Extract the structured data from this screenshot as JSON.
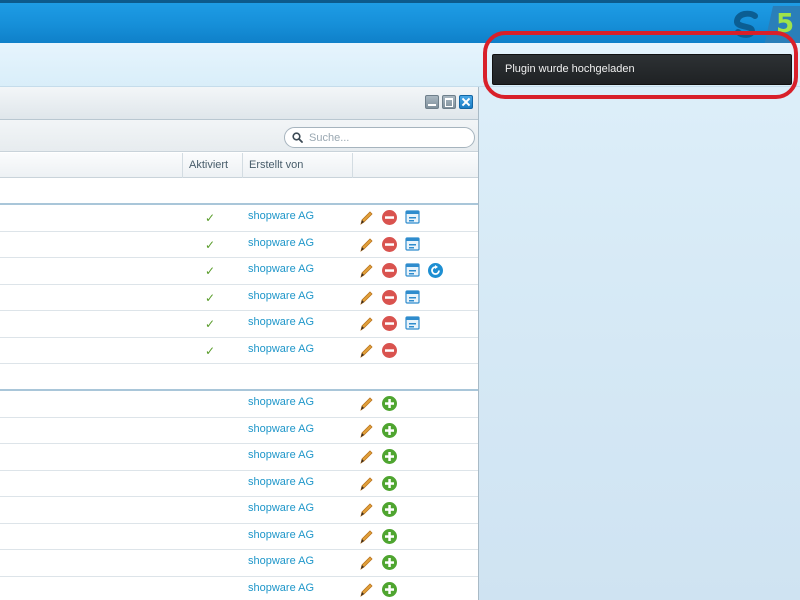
{
  "header": {
    "logo_icon": "shopware-5-logo",
    "logo_text": "5",
    "brand_colors": {
      "bar": "#168fd8",
      "logo_five": "#9fe34a"
    }
  },
  "toolbar": {
    "search_placeholder": "Suche..."
  },
  "table": {
    "columns": [
      "Aktiviert",
      "Erstellt von"
    ],
    "group_installed": [
      {
        "activated": "✓",
        "author": "shopware AG",
        "actions": [
          "edit-icon",
          "uninstall-icon",
          "config-icon"
        ]
      },
      {
        "activated": "✓",
        "author": "shopware AG",
        "actions": [
          "edit-icon",
          "uninstall-icon",
          "config-icon"
        ]
      },
      {
        "activated": "✓",
        "author": "shopware AG",
        "actions": [
          "edit-icon",
          "uninstall-icon",
          "config-icon",
          "reinstall-icon"
        ]
      },
      {
        "activated": "✓",
        "author": "shopware AG",
        "actions": [
          "edit-icon",
          "uninstall-icon",
          "config-icon"
        ]
      },
      {
        "activated": "✓",
        "author": "shopware AG",
        "actions": [
          "edit-icon",
          "uninstall-icon",
          "config-icon"
        ]
      },
      {
        "activated": "✓",
        "author": "shopware AG",
        "actions": [
          "edit-icon",
          "uninstall-icon"
        ]
      }
    ],
    "group_uninstalled": [
      {
        "author": "shopware AG",
        "actions": [
          "edit-icon",
          "install-icon"
        ]
      },
      {
        "author": "shopware AG",
        "actions": [
          "edit-icon",
          "install-icon"
        ]
      },
      {
        "author": "shopware AG",
        "actions": [
          "edit-icon",
          "install-icon"
        ]
      },
      {
        "author": "shopware AG",
        "actions": [
          "edit-icon",
          "install-icon"
        ]
      },
      {
        "author": "shopware AG",
        "actions": [
          "edit-icon",
          "install-icon"
        ]
      },
      {
        "author": "shopware AG",
        "actions": [
          "edit-icon",
          "install-icon"
        ]
      },
      {
        "author": "shopware AG",
        "actions": [
          "edit-icon",
          "install-icon"
        ]
      },
      {
        "author": "shopware AG",
        "actions": [
          "edit-icon",
          "install-icon"
        ]
      }
    ]
  },
  "notification": {
    "message": "Plugin wurde hochgeladen",
    "highlight_color": "#d8202a"
  }
}
